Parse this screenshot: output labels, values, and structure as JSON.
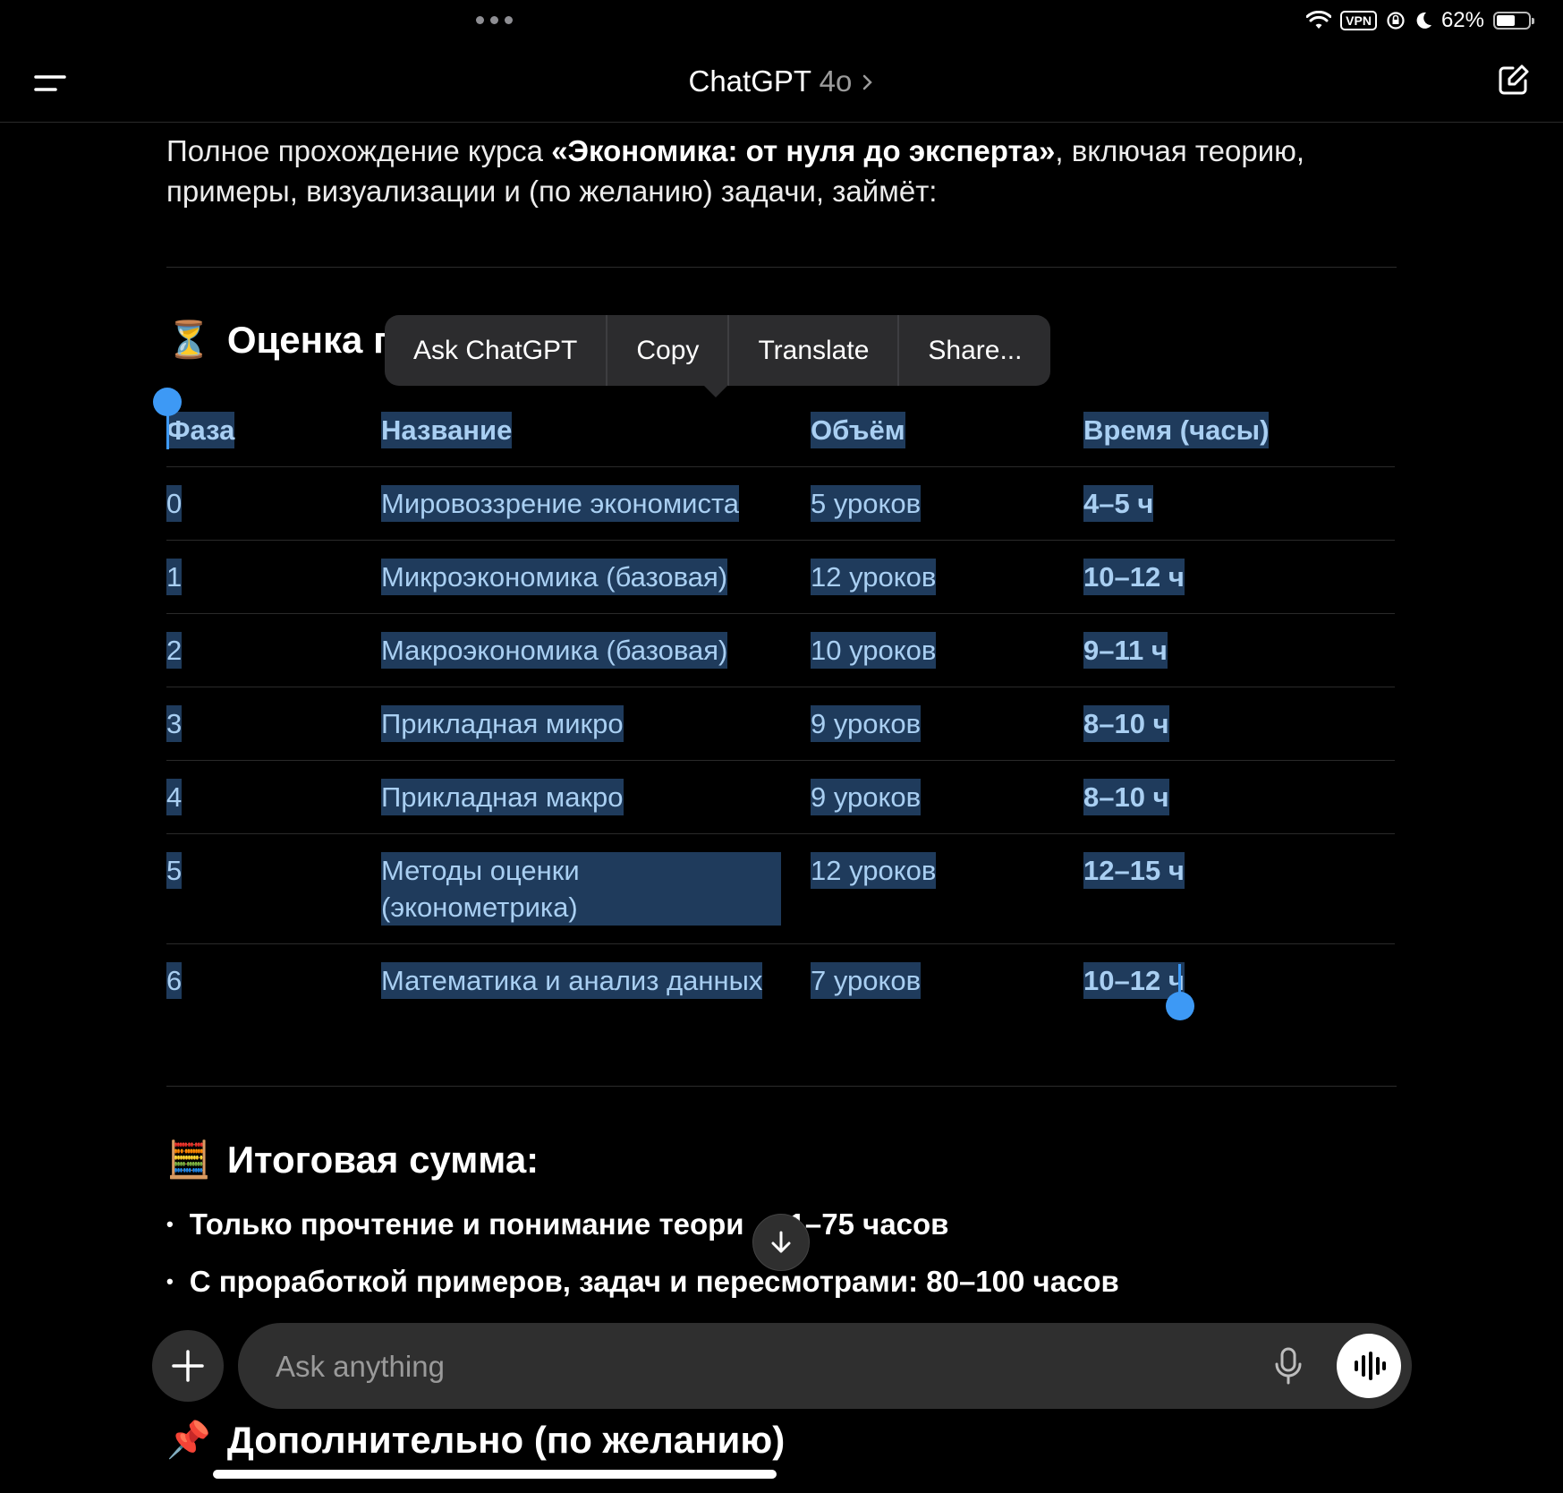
{
  "status_bar": {
    "battery": "62%",
    "vpn": "VPN"
  },
  "header": {
    "title": "ChatGPT",
    "model": "4o"
  },
  "intro": {
    "prefix": "Полное прохождение курса ",
    "course": "«Экономика: от нуля до эксперта»",
    "suffix": ", включая теорию, примеры, визуализации и (по желанию) задачи, займёт:"
  },
  "estimate_heading": {
    "emoji": "⏳",
    "text": "Оценка г"
  },
  "context_menu": {
    "items": [
      "Ask ChatGPT",
      "Copy",
      "Translate",
      "Share..."
    ]
  },
  "table": {
    "headers": [
      "Фаза",
      "Название",
      "Объём",
      "Время (часы)"
    ],
    "rows": [
      [
        "0",
        "Мировоззрение экономиста",
        "5 уроков",
        "4–5 ч"
      ],
      [
        "1",
        "Микроэкономика (базовая)",
        "12 уроков",
        "10–12 ч"
      ],
      [
        "2",
        "Макроэкономика (базовая)",
        "10 уроков",
        "9–11 ч"
      ],
      [
        "3",
        "Прикладная микро",
        "9 уроков",
        "8–10 ч"
      ],
      [
        "4",
        "Прикладная макро",
        "9 уроков",
        "8–10 ч"
      ],
      [
        "5",
        "Методы оценки (эконометрика)",
        "12 уроков",
        "12–15 ч"
      ],
      [
        "6",
        "Математика и анализ данных",
        "7 уроков",
        "10–12 ч"
      ]
    ]
  },
  "total_heading": {
    "emoji": "🧮",
    "text": "Итоговая сумма:"
  },
  "bullets": [
    "Только прочтение и понимание теори... 61–75 часов",
    "С проработкой примеров, задач и пересмотрами: 80–100 часов"
  ],
  "bullets_display": [
    {
      "before": "Только прочтение и понимание теори",
      "after": "1–75 часов"
    },
    {
      "before": "С проработкой примеров, задач и пересмотрами: 80–100 часов",
      "after": ""
    }
  ],
  "extra_heading": {
    "emoji": "📌",
    "text": "Дополнительно (по желанию)"
  },
  "composer": {
    "placeholder": "Ask anything"
  }
}
